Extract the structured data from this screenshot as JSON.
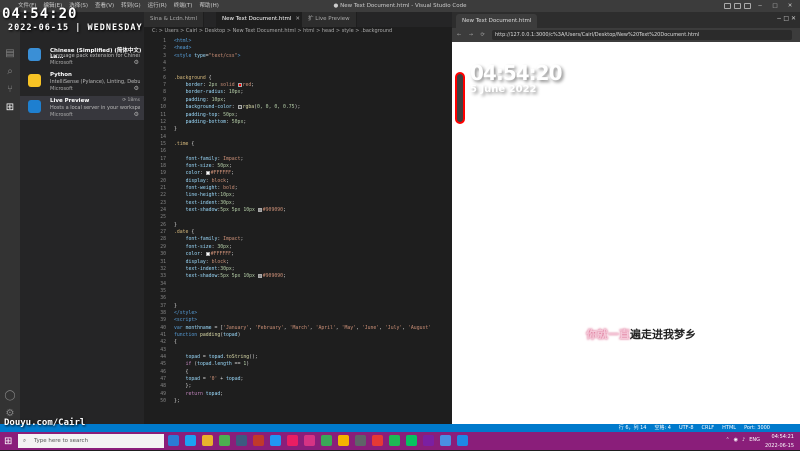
{
  "window": {
    "title": "● New Text Document.html - Visual Studio Code",
    "menu": [
      "文件(F)",
      "编辑(E)",
      "选择(S)",
      "查看(V)",
      "转到(G)",
      "运行(R)",
      "终端(T)",
      "帮助(H)"
    ]
  },
  "overlay": {
    "clock": "04:54:20",
    "date": "2022-06-15 | WEDNESDAY",
    "watermark": "Douyu.com/Cairl"
  },
  "extensions": [
    {
      "name": "Chinese (Simplified) (简体中文) La...",
      "desc": "Language pack extension for Chines...",
      "publisher": "Microsoft",
      "color": "#3a8fd6"
    },
    {
      "name": "Python",
      "desc": "IntelliSense (Pylance), Linting, Debu...",
      "publisher": "Microsoft",
      "color": "#f7c325"
    },
    {
      "name": "Live Preview",
      "desc": "Hosts a local server in your workspa...",
      "publisher": "Microsoft",
      "color": "#1e7fd0",
      "meta": "⟳ 18ms"
    }
  ],
  "editor": {
    "tabs": [
      "Sina & Lcdn.html",
      "New Text Document.html",
      "扩 Live Preview"
    ],
    "breadcrumb": "C: > Users > Cairl > Desktop > New Text Document.html > html > head > style > .background"
  },
  "code": [
    [
      [
        "t-tag",
        "<html>"
      ]
    ],
    [
      [
        "t-tag",
        "<head>"
      ]
    ],
    [
      [
        "t-tag",
        "<style "
      ],
      [
        "t-attr",
        "type"
      ],
      [
        "t-def",
        "="
      ],
      [
        "t-str",
        "\"text/css\""
      ],
      [
        "t-tag",
        ">"
      ]
    ],
    [],
    [],
    [
      [
        "t-sel",
        ".background "
      ],
      [
        "t-def",
        "{"
      ]
    ],
    [
      [
        "t-def",
        "    "
      ],
      [
        "t-prop",
        "border"
      ],
      [
        "t-def",
        ": "
      ],
      [
        "t-num",
        "2px "
      ],
      [
        "t-val",
        "solid "
      ],
      [
        "sw",
        "#ff0000"
      ],
      [
        "t-val",
        "red"
      ],
      [
        "t-def",
        ";"
      ]
    ],
    [
      [
        "t-def",
        "    "
      ],
      [
        "t-prop",
        "border-radius"
      ],
      [
        "t-def",
        ": "
      ],
      [
        "t-num",
        "10px"
      ],
      [
        "t-def",
        ";"
      ]
    ],
    [
      [
        "t-def",
        "    "
      ],
      [
        "t-prop",
        "padding"
      ],
      [
        "t-def",
        ": "
      ],
      [
        "t-num",
        "10px"
      ],
      [
        "t-def",
        ";"
      ]
    ],
    [
      [
        "t-def",
        "    "
      ],
      [
        "t-prop",
        "background-color"
      ],
      [
        "t-def",
        ": "
      ],
      [
        "sw",
        "#404040"
      ],
      [
        "t-fn",
        "rgba"
      ],
      [
        "t-def",
        "("
      ],
      [
        "t-num",
        "0, 0, 0, 0.75"
      ],
      [
        "t-def",
        ");"
      ]
    ],
    [
      [
        "t-def",
        "    "
      ],
      [
        "t-prop",
        "padding-top"
      ],
      [
        "t-def",
        ": "
      ],
      [
        "t-num",
        "50px"
      ],
      [
        "t-def",
        ";"
      ]
    ],
    [
      [
        "t-def",
        "    "
      ],
      [
        "t-prop",
        "padding-bottom"
      ],
      [
        "t-def",
        ": "
      ],
      [
        "t-num",
        "50px"
      ],
      [
        "t-def",
        ";"
      ]
    ],
    [
      [
        "t-def",
        "}"
      ]
    ],
    [],
    [
      [
        "t-sel",
        ".time "
      ],
      [
        "t-def",
        "{"
      ]
    ],
    [],
    [
      [
        "t-def",
        "    "
      ],
      [
        "t-prop",
        "font-family"
      ],
      [
        "t-def",
        ": "
      ],
      [
        "t-val",
        "Impact"
      ],
      [
        "t-def",
        ";"
      ]
    ],
    [
      [
        "t-def",
        "    "
      ],
      [
        "t-prop",
        "font-size"
      ],
      [
        "t-def",
        ": "
      ],
      [
        "t-num",
        "50px"
      ],
      [
        "t-def",
        ";"
      ]
    ],
    [
      [
        "t-def",
        "    "
      ],
      [
        "t-prop",
        "color"
      ],
      [
        "t-def",
        ": "
      ],
      [
        "sw",
        "#ffffff"
      ],
      [
        "t-val",
        "#FFFFFF"
      ],
      [
        "t-def",
        ";"
      ]
    ],
    [
      [
        "t-def",
        "    "
      ],
      [
        "t-prop",
        "display"
      ],
      [
        "t-def",
        ": "
      ],
      [
        "t-val",
        "block"
      ],
      [
        "t-def",
        ";"
      ]
    ],
    [
      [
        "t-def",
        "    "
      ],
      [
        "t-prop",
        "font-weight"
      ],
      [
        "t-def",
        ": "
      ],
      [
        "t-val",
        "bold"
      ],
      [
        "t-def",
        ";"
      ]
    ],
    [
      [
        "t-def",
        "    "
      ],
      [
        "t-prop",
        "line-height"
      ],
      [
        "t-def",
        ":"
      ],
      [
        "t-num",
        "10px"
      ],
      [
        "t-def",
        ";"
      ]
    ],
    [
      [
        "t-def",
        "    "
      ],
      [
        "t-prop",
        "text-indent"
      ],
      [
        "t-def",
        ":"
      ],
      [
        "t-num",
        "30px"
      ],
      [
        "t-def",
        ";"
      ]
    ],
    [
      [
        "t-def",
        "    "
      ],
      [
        "t-prop",
        "text-shadow"
      ],
      [
        "t-def",
        ":"
      ],
      [
        "t-num",
        "5px 5px 10px "
      ],
      [
        "sw",
        "#909090"
      ],
      [
        "t-val",
        "#909090"
      ],
      [
        "t-def",
        ";"
      ]
    ],
    [],
    [
      [
        "t-def",
        "}"
      ]
    ],
    [
      [
        "t-sel",
        ".date "
      ],
      [
        "t-def",
        "{"
      ]
    ],
    [
      [
        "t-def",
        "    "
      ],
      [
        "t-prop",
        "font-family"
      ],
      [
        "t-def",
        ": "
      ],
      [
        "t-val",
        "Impact"
      ],
      [
        "t-def",
        ";"
      ]
    ],
    [
      [
        "t-def",
        "    "
      ],
      [
        "t-prop",
        "font-size"
      ],
      [
        "t-def",
        ": "
      ],
      [
        "t-num",
        "30px"
      ],
      [
        "t-def",
        ";"
      ]
    ],
    [
      [
        "t-def",
        "    "
      ],
      [
        "t-prop",
        "color"
      ],
      [
        "t-def",
        ": "
      ],
      [
        "sw",
        "#ffffff"
      ],
      [
        "t-val",
        "#FFFFFF"
      ],
      [
        "t-def",
        ";"
      ]
    ],
    [
      [
        "t-def",
        "    "
      ],
      [
        "t-prop",
        "display"
      ],
      [
        "t-def",
        ": "
      ],
      [
        "t-val",
        "block"
      ],
      [
        "t-def",
        ";"
      ]
    ],
    [
      [
        "t-def",
        "    "
      ],
      [
        "t-prop",
        "text-indent"
      ],
      [
        "t-def",
        ":"
      ],
      [
        "t-num",
        "30px"
      ],
      [
        "t-def",
        ";"
      ]
    ],
    [
      [
        "t-def",
        "    "
      ],
      [
        "t-prop",
        "text-shadow"
      ],
      [
        "t-def",
        ":"
      ],
      [
        "t-num",
        "5px 5px 10px "
      ],
      [
        "sw",
        "#909090"
      ],
      [
        "t-val",
        "#909090"
      ],
      [
        "t-def",
        ";"
      ]
    ],
    [],
    [],
    [],
    [
      [
        "t-def",
        "}"
      ]
    ],
    [
      [
        "t-tag",
        "</style>"
      ]
    ],
    [
      [
        "t-tag",
        "<script>"
      ]
    ],
    [
      [
        "t-blue",
        "var "
      ],
      [
        "t-var",
        "monthname"
      ],
      [
        "t-def",
        " = ["
      ],
      [
        "t-str",
        "'January'"
      ],
      [
        "t-def",
        ", "
      ],
      [
        "t-str",
        "'February'"
      ],
      [
        "t-def",
        ", "
      ],
      [
        "t-str",
        "'March'"
      ],
      [
        "t-def",
        ", "
      ],
      [
        "t-str",
        "'April'"
      ],
      [
        "t-def",
        ", "
      ],
      [
        "t-str",
        "'May'"
      ],
      [
        "t-def",
        ", "
      ],
      [
        "t-str",
        "'June'"
      ],
      [
        "t-def",
        ", "
      ],
      [
        "t-str",
        "'July'"
      ],
      [
        "t-def",
        ", "
      ],
      [
        "t-str",
        "'August'"
      ]
    ],
    [
      [
        "t-blue",
        "function "
      ],
      [
        "t-fn",
        "padding"
      ],
      [
        "t-def",
        "("
      ],
      [
        "t-var",
        "topad"
      ],
      [
        "t-def",
        ")"
      ]
    ],
    [
      [
        "t-def",
        "{"
      ]
    ],
    [],
    [
      [
        "t-def",
        "    "
      ],
      [
        "t-var",
        "topad"
      ],
      [
        "t-def",
        " = "
      ],
      [
        "t-var",
        "topad"
      ],
      [
        "t-def",
        "."
      ],
      [
        "t-fn",
        "toString"
      ],
      [
        "t-def",
        "();"
      ]
    ],
    [
      [
        "t-def",
        "    "
      ],
      [
        "t-kw",
        "if "
      ],
      [
        "t-def",
        "("
      ],
      [
        "t-var",
        "topad"
      ],
      [
        "t-def",
        "."
      ],
      [
        "t-var",
        "length"
      ],
      [
        "t-def",
        " == "
      ],
      [
        "t-num",
        "1"
      ],
      [
        "t-def",
        ")"
      ]
    ],
    [
      [
        "t-def",
        "    {"
      ]
    ],
    [
      [
        "t-def",
        "    "
      ],
      [
        "t-var",
        "topad"
      ],
      [
        "t-def",
        " = "
      ],
      [
        "t-str",
        "'0'"
      ],
      [
        "t-def",
        " + "
      ],
      [
        "t-var",
        "topad"
      ],
      [
        "t-def",
        ";"
      ]
    ],
    [
      [
        "t-def",
        "    };"
      ]
    ],
    [
      [
        "t-def",
        "    "
      ],
      [
        "t-kw",
        "return "
      ],
      [
        "t-var",
        "topad"
      ],
      [
        "t-def",
        ";"
      ]
    ],
    [
      [
        "t-def",
        "};"
      ]
    ]
  ],
  "preview": {
    "tab": "New Text Document.html",
    "url": "http://127.0.0.1:3000/c%3A/Users/Cairl/Desktop/New%20Text%20Document.html",
    "time": "04:54:20",
    "date": "5 June 2022",
    "lyric_dim": "你就一直",
    "lyric_main": "遍走进我梦乡"
  },
  "statusbar": {
    "items": [
      "行 6，列 14",
      "空格: 4",
      "UTF-8",
      "CRLF",
      "HTML",
      "Port: 3000"
    ]
  },
  "taskbar": {
    "search_placeholder": "Type here to search",
    "icon_colors": [
      "#2b7bd5",
      "#1da1f2",
      "#e8b12c",
      "#4caf50",
      "#3d5a80",
      "#c0392b",
      "#2196f3",
      "#e91e63",
      "#d63384",
      "#3aa757",
      "#f4b400",
      "#5f6368",
      "#e53935",
      "#1db954",
      "#07c160",
      "#7b1fa2",
      "#4a90e2",
      "#1e88e5"
    ],
    "lang": "ENG",
    "time": "04:54:21",
    "date": "2022-06-15"
  }
}
